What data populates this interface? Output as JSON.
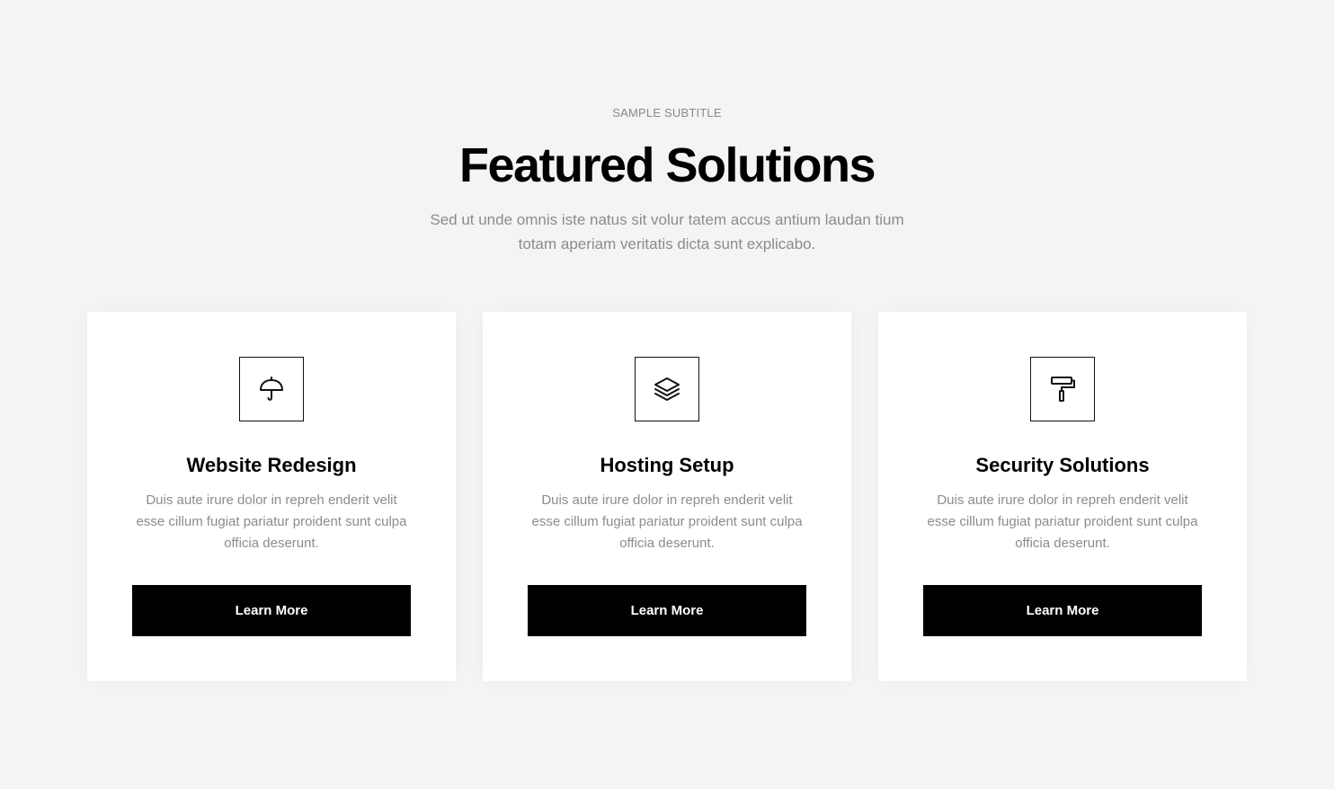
{
  "header": {
    "subtitle": "SAMPLE SUBTITLE",
    "title": "Featured Solutions",
    "intro_line1": "Sed ut unde omnis iste natus sit volur tatem accus antium laudan tium",
    "intro_line2": "totam aperiam veritatis dicta sunt explicabo."
  },
  "cards": [
    {
      "icon": "umbrella-icon",
      "title": "Website Redesign",
      "text": "Duis aute irure dolor in repreh enderit velit esse cillum fugiat pariatur proident sunt culpa officia deserunt.",
      "button_label": "Learn More"
    },
    {
      "icon": "layers-icon",
      "title": "Hosting Setup",
      "text": "Duis aute irure dolor in repreh enderit velit esse cillum fugiat pariatur proident sunt culpa officia deserunt.",
      "button_label": "Learn More"
    },
    {
      "icon": "paint-roller-icon",
      "title": "Security Solutions",
      "text": "Duis aute irure dolor in repreh enderit velit esse cillum fugiat pariatur proident sunt culpa officia deserunt.",
      "button_label": "Learn More"
    }
  ],
  "colors": {
    "background": "#f4f4f4",
    "card": "#ffffff",
    "button": "#000000",
    "muted_text": "#8c8c8c"
  }
}
